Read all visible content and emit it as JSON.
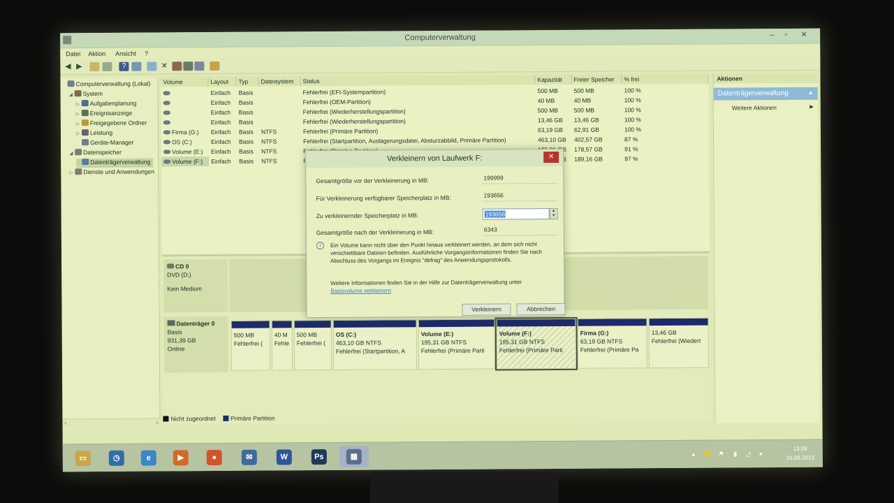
{
  "window": {
    "title": "Computerverwaltung",
    "min": "–",
    "max": "▫",
    "close": "✕"
  },
  "menu": [
    "Datei",
    "Aktion",
    "Ansicht",
    "?"
  ],
  "tree": [
    {
      "label": "Computerverwaltung (Lokal)",
      "level": 0,
      "expander": "",
      "color": "#6f7d8c"
    },
    {
      "label": "System",
      "level": 1,
      "expander": "◢",
      "color": "#7d6a52"
    },
    {
      "label": "Aufgabenplanung",
      "level": 2,
      "expander": "▷",
      "color": "#4f6f8f"
    },
    {
      "label": "Ereignisanzeige",
      "level": 2,
      "expander": "▷",
      "color": "#5c6f52"
    },
    {
      "label": "Freigegebene Ordner",
      "level": 2,
      "expander": "▷",
      "color": "#b89a3c"
    },
    {
      "label": "Leistung",
      "level": 2,
      "expander": "▷",
      "color": "#6b5f6d"
    },
    {
      "label": "Geräte-Manager",
      "level": 2,
      "expander": "",
      "color": "#6f7d8c"
    },
    {
      "label": "Datenspeicher",
      "level": 1,
      "expander": "◢",
      "color": "#7c7f6a"
    },
    {
      "label": "Datenträgerverwaltung",
      "level": 2,
      "expander": "",
      "color": "#5a7b9a",
      "selected": true
    },
    {
      "label": "Dienste und Anwendungen",
      "level": 1,
      "expander": "▷",
      "color": "#7c7f6a"
    }
  ],
  "table": {
    "columns": [
      "Volume",
      "Layout",
      "Typ",
      "Dateisystem",
      "Status",
      "Kapazität",
      "Freier Speicher",
      "% frei"
    ],
    "rows": [
      [
        "",
        "Einfach",
        "Basis",
        "",
        "Fehlerfrei (EFI-Systempartition)",
        "500 MB",
        "500 MB",
        "100 %"
      ],
      [
        "",
        "Einfach",
        "Basis",
        "",
        "Fehlerfrei (OEM-Partition)",
        "40 MB",
        "40 MB",
        "100 %"
      ],
      [
        "",
        "Einfach",
        "Basis",
        "",
        "Fehlerfrei (Wiederherstellungspartition)",
        "500 MB",
        "500 MB",
        "100 %"
      ],
      [
        "",
        "Einfach",
        "Basis",
        "",
        "Fehlerfrei (Wiederherstellungspartition)",
        "13,46 GB",
        "13,46 GB",
        "100 %"
      ],
      [
        "Firma (G:)",
        "Einfach",
        "Basis",
        "NTFS",
        "Fehlerfrei (Primäre Partition)",
        "63,19 GB",
        "62,91 GB",
        "100 %"
      ],
      [
        "OS (C:)",
        "Einfach",
        "Basis",
        "NTFS",
        "Fehlerfrei (Startpartition, Auslagerungsdatei, Absturzabbild, Primäre Partition)",
        "463,10 GB",
        "402,57 GB",
        "87 %"
      ],
      [
        "Volume (E:)",
        "Einfach",
        "Basis",
        "NTFS",
        "Fehlerfrei (Primäre Partition)",
        "195,31 GB",
        "178,57 GB",
        "91 %"
      ],
      [
        "Volume (F:)",
        "Einfach",
        "Basis",
        "NTFS",
        "Fehlerfrei (Primäre Partition)",
        "195,31 GB",
        "189,16 GB",
        "97 %"
      ]
    ]
  },
  "cd": {
    "name": "CD 0",
    "type": "DVD (D:)",
    "status": "Kein Medium"
  },
  "disk0": {
    "name": "Datenträger 0",
    "type": "Basis",
    "size": "931,39 GB",
    "status": "Online",
    "partitions": [
      {
        "name": "",
        "size": "500 MB",
        "status": "Fehlerfrei ("
      },
      {
        "name": "",
        "size": "40 M",
        "status": "Fehle"
      },
      {
        "name": "",
        "size": "500 MB",
        "status": "Fehlerfrei ("
      },
      {
        "name": "OS (C:)",
        "size": "463,10 GB NTFS",
        "status": "Fehlerfrei (Startpartition, A"
      },
      {
        "name": "Volume (E:)",
        "size": "195,31 GB NTFS",
        "status": "Fehlerfrei (Primäre Parti"
      },
      {
        "name": "Volume (F:)",
        "size": "195,31 GB NTFS",
        "status": "Fehlerfrei (Primäre Parti"
      },
      {
        "name": "Firma (G:)",
        "size": "63,19 GB NTFS",
        "status": "Fehlerfrei (Primäre Pa"
      },
      {
        "name": "",
        "size": "13,46 GB",
        "status": "Fehlerfrei (Wiedert"
      }
    ]
  },
  "legend": {
    "unallocated": "Nicht zugeordnet",
    "primary": "Primäre Partition",
    "unallocated_color": "#111111",
    "primary_color": "#1d2a6d"
  },
  "actions": {
    "header": "Aktionen",
    "section": "Datenträgerverwaltung",
    "more": "Weitere Aktionen"
  },
  "dialog": {
    "title": "Verkleinern von Laufwerk F:",
    "close": "✕",
    "rows": [
      {
        "label": "Gesamtgröße vor der Verkleinerung in MB:",
        "value": "199999"
      },
      {
        "label": "Für Verkleinerung verfügbarer Speicherplatz in MB:",
        "value": "193656"
      },
      {
        "label": "Zu verkleinernder Speicherplatz in MB:",
        "value": "193656"
      },
      {
        "label": "Gesamtgröße nach der Verkleinerung in MB:",
        "value": "6343"
      }
    ],
    "info": "Ein Volume kann nicht über den Punkt hinaus verkleinert werden, an dem sich nicht verschiebbare Dateien befinden. Ausführliche Vorgangsinformationen finden Sie nach Abschluss des Vorgangs im Ereignis \"defrag\" des Anwendungsprotokolls.",
    "help_text": "Weitere Informationen finden Sie in der Hilfe zur Datenträgerverwaltung unter",
    "help_link": "Basisvolume verkleinern",
    "ok": "Verkleinern",
    "cancel": "Abbrechen"
  },
  "taskbar": {
    "apps": [
      {
        "name": "file-explorer",
        "glyph": "▭",
        "color": "#c9a64a"
      },
      {
        "name": "clock-app",
        "glyph": "◷",
        "color": "#2f6fa8"
      },
      {
        "name": "internet-explorer",
        "glyph": "e",
        "color": "#3a86c8"
      },
      {
        "name": "media-player",
        "glyph": "▶",
        "color": "#d46a2a"
      },
      {
        "name": "firefox",
        "glyph": "●",
        "color": "#d2552a"
      },
      {
        "name": "thunderbird",
        "glyph": "✉",
        "color": "#3d6c9c"
      },
      {
        "name": "word",
        "glyph": "W",
        "color": "#2b579a"
      },
      {
        "name": "photoshop",
        "glyph": "Ps",
        "color": "#1e3a5a"
      },
      {
        "name": "computer-management",
        "glyph": "▦",
        "color": "#5a6f8a"
      }
    ],
    "time": "13:09",
    "date": "16.09.2013"
  }
}
